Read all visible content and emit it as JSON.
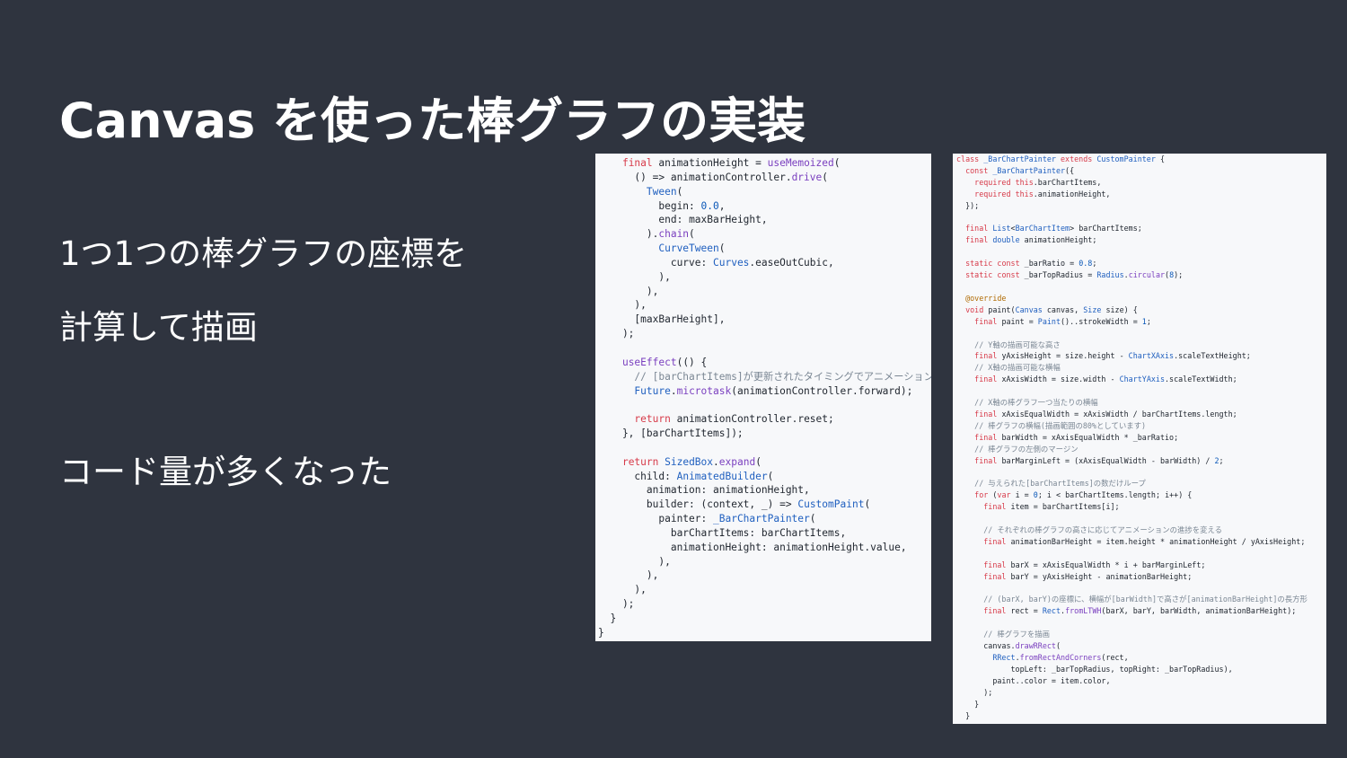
{
  "slide": {
    "title": "Canvas を使った棒グラフの実装",
    "bullets": [
      "1つ1つの棒グラフの座標を",
      "計算して描画",
      "コード量が多くなった"
    ]
  },
  "code_left": {
    "lines": [
      "    final animationHeight = useMemoized(",
      "      () => animationController.drive(",
      "        Tween(",
      "          begin: 0.0,",
      "          end: maxBarHeight,",
      "        ).chain(",
      "          CurveTween(",
      "            curve: Curves.easeOutCubic,",
      "          ),",
      "        ),",
      "      ),",
      "      [maxBarHeight],",
      "    );",
      "",
      "    useEffect(() {",
      "      // [barChartItems]が更新されたタイミングでアニメーション発火",
      "      Future.microtask(animationController.forward);",
      "",
      "      return animationController.reset;",
      "    }, [barChartItems]);",
      "",
      "    return SizedBox.expand(",
      "      child: AnimatedBuilder(",
      "        animation: animationHeight,",
      "        builder: (context, _) => CustomPaint(",
      "          painter: _BarChartPainter(",
      "            barChartItems: barChartItems,",
      "            animationHeight: animationHeight.value,",
      "          ),",
      "        ),",
      "      ),",
      "    );",
      "  }",
      "}"
    ]
  },
  "code_right": {
    "lines": [
      "class _BarChartPainter extends CustomPainter {",
      "  const _BarChartPainter({",
      "    required this.barChartItems,",
      "    required this.animationHeight,",
      "  });",
      "",
      "  final List<BarChartItem> barChartItems;",
      "  final double animationHeight;",
      "",
      "  static const _barRatio = 0.8;",
      "  static const _barTopRadius = Radius.circular(8);",
      "",
      "  @override",
      "  void paint(Canvas canvas, Size size) {",
      "    final paint = Paint()..strokeWidth = 1;",
      "",
      "    // Y軸の描画可能な高さ",
      "    final yAxisHeight = size.height - ChartXAxis.scaleTextHeight;",
      "    // X軸の描画可能な横幅",
      "    final xAxisWidth = size.width - ChartYAxis.scaleTextWidth;",
      "",
      "    // X軸の棒グラフ一つ当たりの横幅",
      "    final xAxisEqualWidth = xAxisWidth / barChartItems.length;",
      "    // 棒グラフの横幅(描画範囲の80%としています)",
      "    final barWidth = xAxisEqualWidth * _barRatio;",
      "    // 棒グラフの左側のマージン",
      "    final barMarginLeft = (xAxisEqualWidth - barWidth) / 2;",
      "",
      "    // 与えられた[barChartItems]の数だけループ",
      "    for (var i = 0; i < barChartItems.length; i++) {",
      "      final item = barChartItems[i];",
      "",
      "      // それぞれの棒グラフの高さに応じてアニメーションの進捗を変える",
      "      final animationBarHeight = item.height * animationHeight / yAxisHeight;",
      "",
      "      final barX = xAxisEqualWidth * i + barMarginLeft;",
      "      final barY = yAxisHeight - animationBarHeight;",
      "",
      "      // (barX, barY)の座標に、横幅が[barWidth]で高さが[animationBarHeight]の長方形",
      "      final rect = Rect.fromLTWH(barX, barY, barWidth, animationBarHeight);",
      "",
      "      // 棒グラフを描画",
      "      canvas.drawRRect(",
      "        RRect.fromRectAndCorners(rect,",
      "            topLeft: _barTopRadius, topRight: _barTopRadius),",
      "        paint..color = item.color,",
      "      );",
      "    }",
      "  }"
    ]
  }
}
